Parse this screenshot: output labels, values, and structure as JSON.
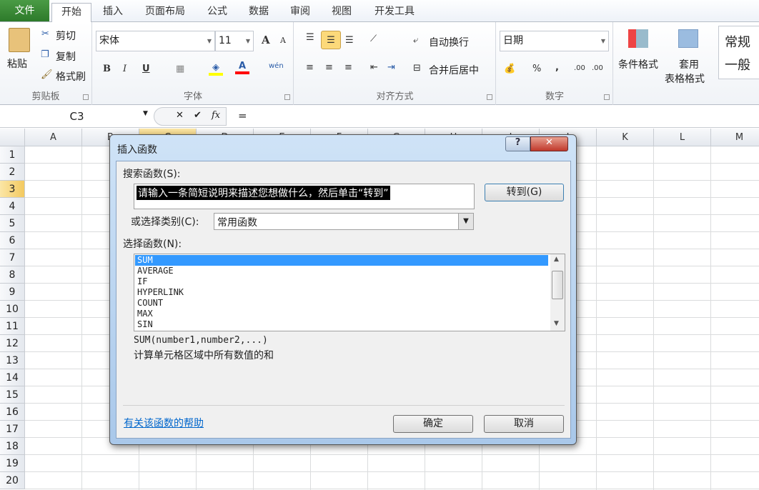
{
  "tabs": [
    "文件",
    "开始",
    "插入",
    "页面布局",
    "公式",
    "数据",
    "审阅",
    "视图",
    "开发工具"
  ],
  "active_tab": "开始",
  "clipboard": {
    "paste": "粘贴",
    "cut": "剪切",
    "copy": "复制",
    "format_painter": "格式刷",
    "label": "剪贴板"
  },
  "font": {
    "name": "宋体",
    "size": "11",
    "label": "字体",
    "bold": "B",
    "italic": "I",
    "underline": "U",
    "grow": "A",
    "shrink": "A",
    "font_color": "A",
    "phonetic": "wén",
    "fill_color": "#ffff00",
    "font_color_hex": "#ff0000"
  },
  "alignment": {
    "wrap": "自动换行",
    "merge": "合并后居中",
    "label": "对齐方式"
  },
  "number": {
    "format": "日期",
    "percent": "%",
    "comma": ",",
    "inc_dec": ".00",
    "label": "数字"
  },
  "styles": {
    "conditional": "条件格式",
    "table1": "套用",
    "table2": "表格格式",
    "normal": "常规",
    "general": "一般"
  },
  "formula_bar": {
    "name_box": "C3",
    "cancel": "✕",
    "enter": "✔",
    "fx": "fx",
    "content": "="
  },
  "columns": [
    "A",
    "B",
    "C",
    "D",
    "E",
    "F",
    "G",
    "H",
    "I",
    "J",
    "K",
    "L",
    "M"
  ],
  "selected_column": "C",
  "selected_row": 3,
  "rows": [
    1,
    2,
    3,
    4,
    5,
    6,
    7,
    8,
    9,
    10,
    11,
    12,
    13,
    14,
    15,
    16,
    17,
    18,
    19,
    20
  ],
  "dialog": {
    "title": "插入函数",
    "help": "?",
    "close": "✕",
    "search_label": "搜索函数(S):",
    "search_value": "请输入一条简短说明来描述您想做什么，然后单击“转到”",
    "go_button": "转到(G)",
    "category_label": "或选择类别(C):",
    "category_value": "常用函数",
    "select_label": "选择函数(N):",
    "functions": [
      "SUM",
      "AVERAGE",
      "IF",
      "HYPERLINK",
      "COUNT",
      "MAX",
      "SIN"
    ],
    "selected_function": "SUM",
    "signature": "SUM(number1,number2,...)",
    "description": "计算单元格区域中所有数值的和",
    "help_link": "有关该函数的帮助",
    "ok": "确定",
    "cancel": "取消"
  }
}
